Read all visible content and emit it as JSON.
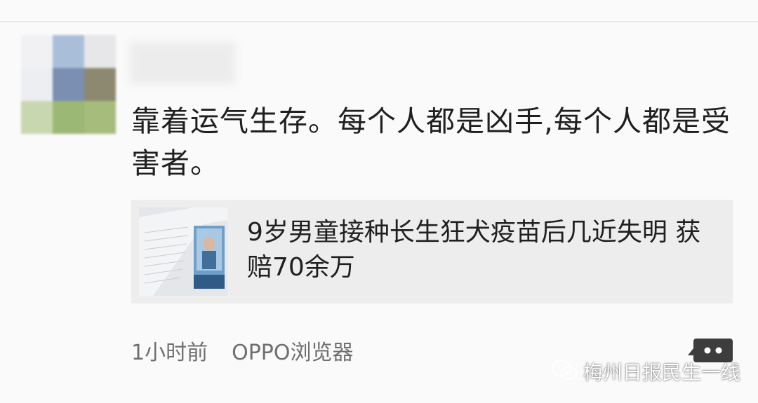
{
  "colors": {
    "background": "#fafafa",
    "card_background": "#ededed",
    "post_text": "#1f1f1f",
    "meta_text": "#6f6f6f",
    "comment_button": "#3d3d3d"
  },
  "post": {
    "text": "靠着运气生存。每个人都是凶手,每个人都是受害者。"
  },
  "link_card": {
    "title": "9岁男童接种长生狂犬疫苗后几近失明 获赔70余万",
    "thumbnail_icon": "news-photo-thumbnail"
  },
  "meta": {
    "time": "1小时前",
    "source": "OPPO浏览器"
  },
  "comment_button": {
    "icon": "comment-bubble-icon"
  },
  "watermark": {
    "icon": "wechat-icon",
    "text": "梅州日报民生一线"
  }
}
